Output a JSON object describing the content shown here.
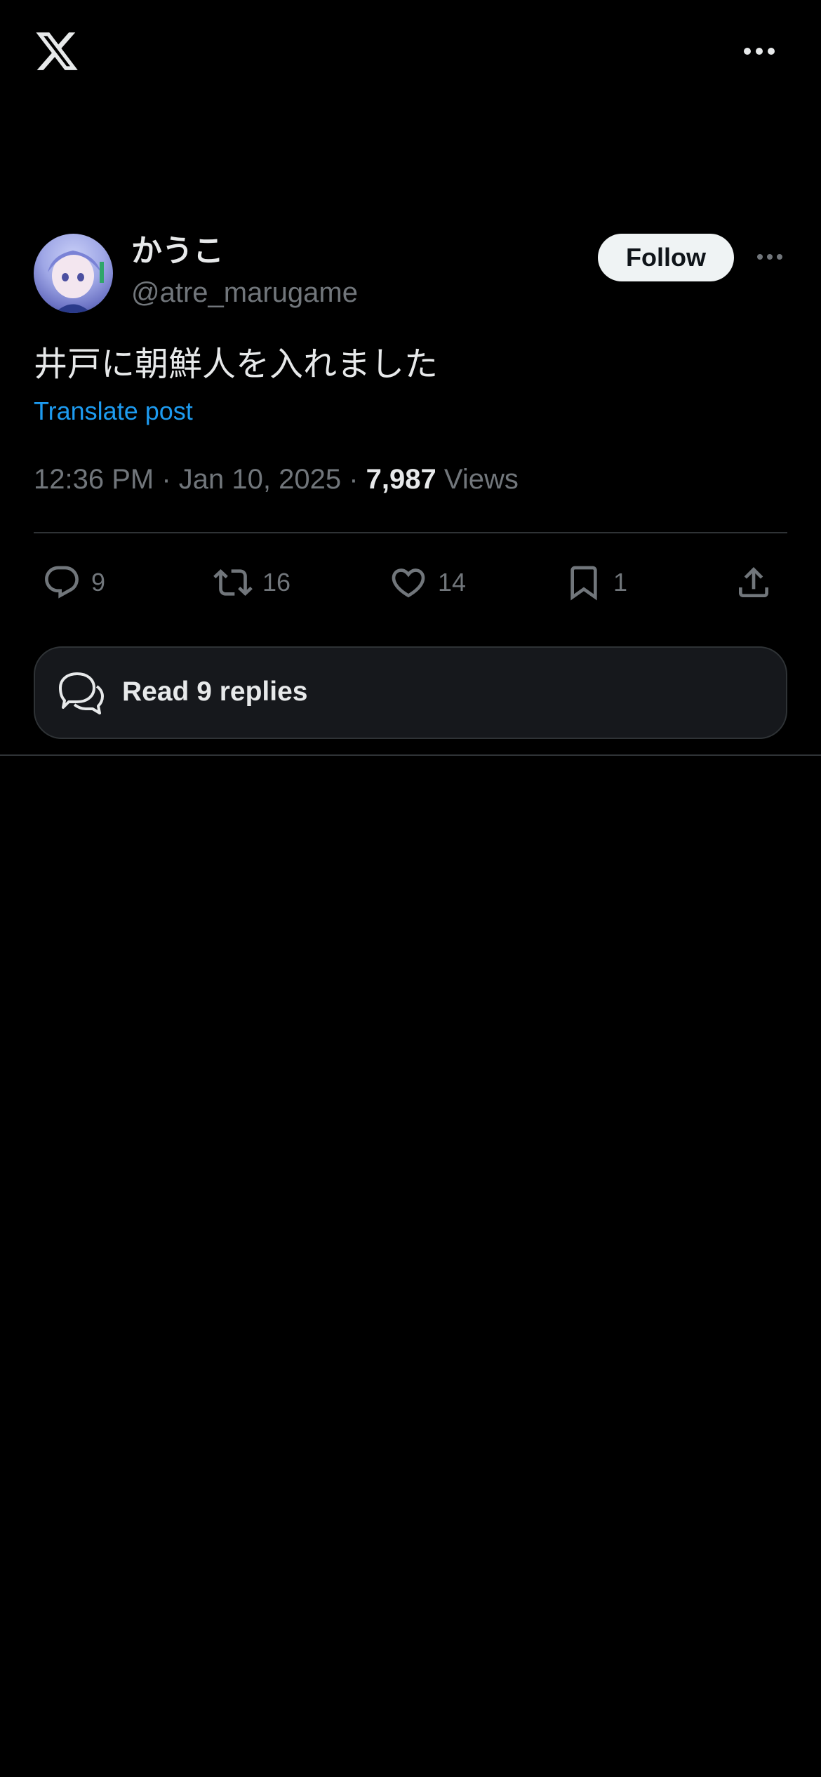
{
  "header": {
    "logo_icon": "x-logo-icon",
    "menu_icon": "more-horizontal-icon"
  },
  "author": {
    "display_name": "かうこ",
    "handle": "@atre_marugame",
    "follow_label": "Follow"
  },
  "post": {
    "text": "井戸に朝鮮人を入れました",
    "translate_label": "Translate post",
    "time": "12:36 PM",
    "date": "Jan 10, 2025",
    "views_count": "7,987",
    "views_label": "Views"
  },
  "actions": {
    "replies": "9",
    "reposts": "16",
    "likes": "14",
    "bookmarks": "1"
  },
  "read_replies": {
    "label": "Read 9 replies"
  },
  "colors": {
    "background": "#000000",
    "text": "#e7e9ea",
    "muted": "#71767b",
    "link": "#1d9bf0",
    "divider": "#2f3336"
  }
}
